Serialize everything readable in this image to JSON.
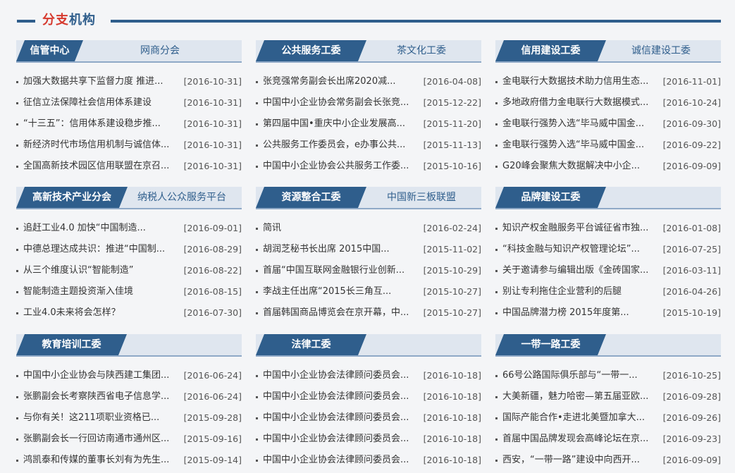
{
  "section_title": {
    "red": "分支",
    "blue": "机构"
  },
  "panels": [
    {
      "active_tab": "信管中心",
      "inactive_tab": "网商分会",
      "items": [
        {
          "text": "加强大数据共享下监督力度 推进...",
          "date": "[2016-10-31]"
        },
        {
          "text": "征信立法保障社会信用体系建设",
          "date": "[2016-10-31]"
        },
        {
          "text": "“十三五”：信用体系建设稳步推...",
          "date": "[2016-10-31]"
        },
        {
          "text": "新经济时代市场信用机制与诚信体...",
          "date": "[2016-10-31]"
        },
        {
          "text": "全国高新技术园区信用联盟在京召...",
          "date": "[2016-10-31]"
        }
      ]
    },
    {
      "active_tab": "公共服务工委",
      "inactive_tab": "茶文化工委",
      "items": [
        {
          "text": "张竞强常务副会长出席2020减...",
          "date": "[2016-04-08]"
        },
        {
          "text": "中国中小企业协会常务副会长张竞...",
          "date": "[2015-12-22]"
        },
        {
          "text": "第四届中国•重庆中小企业发展高...",
          "date": "[2015-11-20]"
        },
        {
          "text": "公共服务工作委员会，e办事公共...",
          "date": "[2015-11-13]"
        },
        {
          "text": "中国中小企业协会公共服务工作委...",
          "date": "[2015-10-16]"
        }
      ]
    },
    {
      "active_tab": "信用建设工委",
      "inactive_tab": "诚信建设工委",
      "items": [
        {
          "text": "金电联行大数据技术助力信用生态...",
          "date": "[2016-11-01]"
        },
        {
          "text": "多地政府借力金电联行大数据模式...",
          "date": "[2016-10-24]"
        },
        {
          "text": "金电联行强势入选“毕马威中国金...",
          "date": "[2016-09-30]"
        },
        {
          "text": "金电联行强势入选“毕马威中国金...",
          "date": "[2016-09-22]"
        },
        {
          "text": "G20峰会聚焦大数据解决中小企...",
          "date": "[2016-09-09]"
        }
      ]
    },
    {
      "active_tab": "高新技术产业分会",
      "inactive_tab": "纳税人公众服务平台",
      "items": [
        {
          "text": "追赶工业4.0 加快“中国制造...",
          "date": "[2016-09-01]"
        },
        {
          "text": "中德总理达成共识：推进“中国制...",
          "date": "[2016-08-29]"
        },
        {
          "text": "从三个维度认识“智能制造”",
          "date": "[2016-08-22]"
        },
        {
          "text": "智能制造主题投资渐入佳境",
          "date": "[2016-08-15]"
        },
        {
          "text": "工业4.0未来将会怎样？",
          "date": "[2016-07-30]"
        }
      ]
    },
    {
      "active_tab": "资源整合工委",
      "inactive_tab": "中国新三板联盟",
      "items": [
        {
          "text": "简讯",
          "date": "[2016-02-24]"
        },
        {
          "text": "胡润芝秘书长出席 2015中国...",
          "date": "[2015-11-02]"
        },
        {
          "text": "首届“中国互联网金融银行业创新...",
          "date": "[2015-10-29]"
        },
        {
          "text": "李战主任出席“2015长三角互...",
          "date": "[2015-10-27]"
        },
        {
          "text": "首届韩国商品博览会在京开幕，中...",
          "date": "[2015-10-27]"
        }
      ]
    },
    {
      "active_tab": "品牌建设工委",
      "inactive_tab": "",
      "items": [
        {
          "text": "知识产权金融服务平台诚征省市独...",
          "date": "[2016-01-08]"
        },
        {
          "text": "“科技金融与知识产权管理论坛”...",
          "date": "[2016-07-25]"
        },
        {
          "text": "关于邀请参与编辑出版《金砖国家...",
          "date": "[2016-03-11]"
        },
        {
          "text": "别让专利拖住企业营利的后腿",
          "date": "[2016-04-26]"
        },
        {
          "text": "中国品牌潜力榜 2015年度第...",
          "date": "[2015-10-19]"
        }
      ]
    },
    {
      "active_tab": "教育培训工委",
      "inactive_tab": "",
      "items": [
        {
          "text": "中国中小企业协会与陕西建工集团...",
          "date": "[2016-06-24]"
        },
        {
          "text": "张鹏副会长考察陕西省电子信息学...",
          "date": "[2016-06-24]"
        },
        {
          "text": "与你有关！这211项职业资格已...",
          "date": "[2015-09-28]"
        },
        {
          "text": "张鹏副会长一行回访南通市通州区...",
          "date": "[2015-09-16]"
        },
        {
          "text": "鸿凯泰和传媒的董事长刘有为先生...",
          "date": "[2015-09-14]"
        }
      ]
    },
    {
      "active_tab": "法律工委",
      "inactive_tab": "",
      "items": [
        {
          "text": "中国中小企业协会法律顾问委员会...",
          "date": "[2016-10-18]"
        },
        {
          "text": "中国中小企业协会法律顾问委员会...",
          "date": "[2016-10-18]"
        },
        {
          "text": "中国中小企业协会法律顾问委员会...",
          "date": "[2016-10-18]"
        },
        {
          "text": "中国中小企业协会法律顾问委员会...",
          "date": "[2016-10-18]"
        },
        {
          "text": "中国中小企业协会法律顾问委员会...",
          "date": "[2016-10-18]"
        }
      ]
    },
    {
      "active_tab": "一带一路工委",
      "inactive_tab": "",
      "items": [
        {
          "text": "66号公路国际俱乐部与“一带一...",
          "date": "[2016-10-25]"
        },
        {
          "text": "大美新疆，魅力哈密—第五届亚欧...",
          "date": "[2016-09-28]"
        },
        {
          "text": "国际产能合作•走进北美暨加拿大...",
          "date": "[2016-09-26]"
        },
        {
          "text": "首届中国品牌发现会高峰论坛在京...",
          "date": "[2016-09-23]"
        },
        {
          "text": "西安，“一带一路”建设中向西开...",
          "date": "[2016-09-09]"
        }
      ]
    }
  ]
}
